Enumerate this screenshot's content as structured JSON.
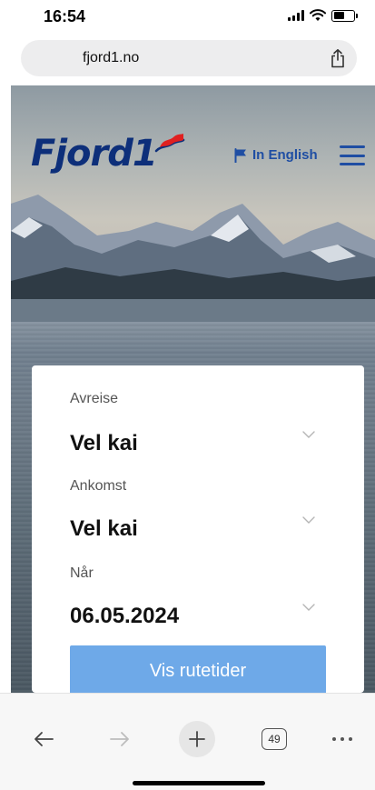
{
  "status_bar": {
    "time": "16:54",
    "icons": [
      "signal-icon",
      "wifi-icon",
      "battery-icon"
    ]
  },
  "browser": {
    "url": "fjord1.no",
    "share_icon": "share-icon",
    "open_tab_count": "49",
    "toolbar_icons": [
      "back-arrow-icon",
      "forward-arrow-icon",
      "plus-icon",
      "tabs-icon",
      "more-icon"
    ]
  },
  "header": {
    "logo_text": "Fjord1",
    "language_link": "In English",
    "language_icon": "flag-icon",
    "menu_icon": "hamburger-menu-icon"
  },
  "search_form": {
    "departure_label": "Avreise",
    "departure_value": "Vel kai",
    "arrival_label": "Ankomst",
    "arrival_value": "Vel kai",
    "date_label": "Når",
    "date_value": "06.05.2024",
    "submit_label": "Vis rutetider"
  },
  "colors": {
    "brand_blue": "#0d2f7a",
    "link_blue": "#1f4ea3",
    "button_blue": "#6ea9e8",
    "button_dark_blue": "#1a6fd4",
    "flag_red": "#e02020"
  }
}
